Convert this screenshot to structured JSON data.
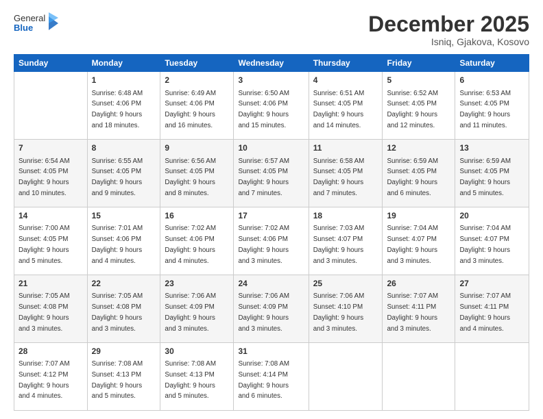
{
  "logo": {
    "text_general": "General",
    "text_blue": "Blue"
  },
  "header": {
    "title": "December 2025",
    "subtitle": "Isniq, Gjakova, Kosovo"
  },
  "weekdays": [
    "Sunday",
    "Monday",
    "Tuesday",
    "Wednesday",
    "Thursday",
    "Friday",
    "Saturday"
  ],
  "weeks": [
    [
      {
        "day": "",
        "info": ""
      },
      {
        "day": "1",
        "info": "Sunrise: 6:48 AM\nSunset: 4:06 PM\nDaylight: 9 hours\nand 18 minutes."
      },
      {
        "day": "2",
        "info": "Sunrise: 6:49 AM\nSunset: 4:06 PM\nDaylight: 9 hours\nand 16 minutes."
      },
      {
        "day": "3",
        "info": "Sunrise: 6:50 AM\nSunset: 4:06 PM\nDaylight: 9 hours\nand 15 minutes."
      },
      {
        "day": "4",
        "info": "Sunrise: 6:51 AM\nSunset: 4:05 PM\nDaylight: 9 hours\nand 14 minutes."
      },
      {
        "day": "5",
        "info": "Sunrise: 6:52 AM\nSunset: 4:05 PM\nDaylight: 9 hours\nand 12 minutes."
      },
      {
        "day": "6",
        "info": "Sunrise: 6:53 AM\nSunset: 4:05 PM\nDaylight: 9 hours\nand 11 minutes."
      }
    ],
    [
      {
        "day": "7",
        "info": "Sunrise: 6:54 AM\nSunset: 4:05 PM\nDaylight: 9 hours\nand 10 minutes."
      },
      {
        "day": "8",
        "info": "Sunrise: 6:55 AM\nSunset: 4:05 PM\nDaylight: 9 hours\nand 9 minutes."
      },
      {
        "day": "9",
        "info": "Sunrise: 6:56 AM\nSunset: 4:05 PM\nDaylight: 9 hours\nand 8 minutes."
      },
      {
        "day": "10",
        "info": "Sunrise: 6:57 AM\nSunset: 4:05 PM\nDaylight: 9 hours\nand 7 minutes."
      },
      {
        "day": "11",
        "info": "Sunrise: 6:58 AM\nSunset: 4:05 PM\nDaylight: 9 hours\nand 7 minutes."
      },
      {
        "day": "12",
        "info": "Sunrise: 6:59 AM\nSunset: 4:05 PM\nDaylight: 9 hours\nand 6 minutes."
      },
      {
        "day": "13",
        "info": "Sunrise: 6:59 AM\nSunset: 4:05 PM\nDaylight: 9 hours\nand 5 minutes."
      }
    ],
    [
      {
        "day": "14",
        "info": "Sunrise: 7:00 AM\nSunset: 4:05 PM\nDaylight: 9 hours\nand 5 minutes."
      },
      {
        "day": "15",
        "info": "Sunrise: 7:01 AM\nSunset: 4:06 PM\nDaylight: 9 hours\nand 4 minutes."
      },
      {
        "day": "16",
        "info": "Sunrise: 7:02 AM\nSunset: 4:06 PM\nDaylight: 9 hours\nand 4 minutes."
      },
      {
        "day": "17",
        "info": "Sunrise: 7:02 AM\nSunset: 4:06 PM\nDaylight: 9 hours\nand 3 minutes."
      },
      {
        "day": "18",
        "info": "Sunrise: 7:03 AM\nSunset: 4:07 PM\nDaylight: 9 hours\nand 3 minutes."
      },
      {
        "day": "19",
        "info": "Sunrise: 7:04 AM\nSunset: 4:07 PM\nDaylight: 9 hours\nand 3 minutes."
      },
      {
        "day": "20",
        "info": "Sunrise: 7:04 AM\nSunset: 4:07 PM\nDaylight: 9 hours\nand 3 minutes."
      }
    ],
    [
      {
        "day": "21",
        "info": "Sunrise: 7:05 AM\nSunset: 4:08 PM\nDaylight: 9 hours\nand 3 minutes."
      },
      {
        "day": "22",
        "info": "Sunrise: 7:05 AM\nSunset: 4:08 PM\nDaylight: 9 hours\nand 3 minutes."
      },
      {
        "day": "23",
        "info": "Sunrise: 7:06 AM\nSunset: 4:09 PM\nDaylight: 9 hours\nand 3 minutes."
      },
      {
        "day": "24",
        "info": "Sunrise: 7:06 AM\nSunset: 4:09 PM\nDaylight: 9 hours\nand 3 minutes."
      },
      {
        "day": "25",
        "info": "Sunrise: 7:06 AM\nSunset: 4:10 PM\nDaylight: 9 hours\nand 3 minutes."
      },
      {
        "day": "26",
        "info": "Sunrise: 7:07 AM\nSunset: 4:11 PM\nDaylight: 9 hours\nand 3 minutes."
      },
      {
        "day": "27",
        "info": "Sunrise: 7:07 AM\nSunset: 4:11 PM\nDaylight: 9 hours\nand 4 minutes."
      }
    ],
    [
      {
        "day": "28",
        "info": "Sunrise: 7:07 AM\nSunset: 4:12 PM\nDaylight: 9 hours\nand 4 minutes."
      },
      {
        "day": "29",
        "info": "Sunrise: 7:08 AM\nSunset: 4:13 PM\nDaylight: 9 hours\nand 5 minutes."
      },
      {
        "day": "30",
        "info": "Sunrise: 7:08 AM\nSunset: 4:13 PM\nDaylight: 9 hours\nand 5 minutes."
      },
      {
        "day": "31",
        "info": "Sunrise: 7:08 AM\nSunset: 4:14 PM\nDaylight: 9 hours\nand 6 minutes."
      },
      {
        "day": "",
        "info": ""
      },
      {
        "day": "",
        "info": ""
      },
      {
        "day": "",
        "info": ""
      }
    ]
  ]
}
